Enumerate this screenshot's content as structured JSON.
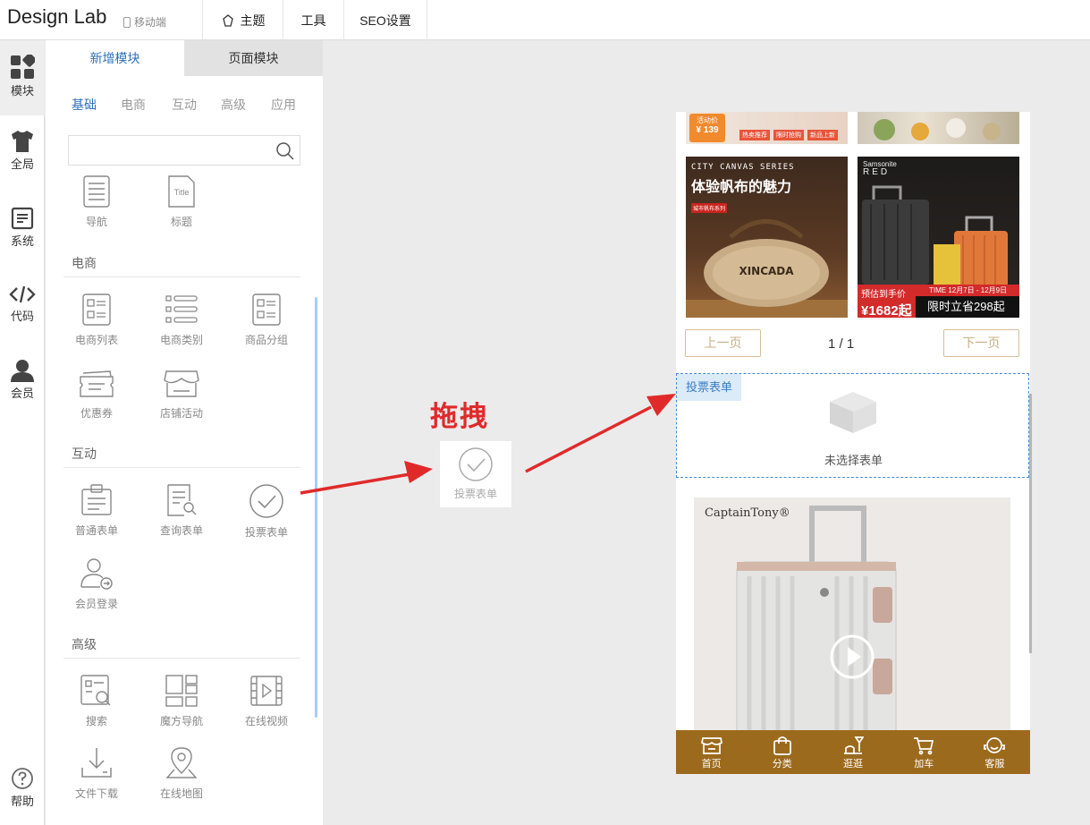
{
  "app": {
    "title": "Design Lab",
    "mobile_label": "移动端"
  },
  "topmenu": [
    {
      "label": "主题",
      "icon": "theme-icon"
    },
    {
      "label": "工具",
      "icon": ""
    },
    {
      "label": "SEO设置",
      "icon": ""
    }
  ],
  "leftbar": {
    "items": [
      {
        "label": "模块",
        "icon": "modules-icon",
        "active": true
      },
      {
        "label": "全局",
        "icon": "shirt-icon"
      },
      {
        "label": "系统",
        "icon": "document-icon"
      },
      {
        "label": "代码",
        "icon": "code-icon"
      },
      {
        "label": "会员",
        "icon": "user-icon"
      }
    ],
    "help": "帮助"
  },
  "panel": {
    "tabs": [
      {
        "label": "新增模块",
        "active": true
      },
      {
        "label": "页面模块",
        "active": false
      }
    ],
    "categories": [
      {
        "label": "基础",
        "active": true
      },
      {
        "label": "电商"
      },
      {
        "label": "互动"
      },
      {
        "label": "高级"
      },
      {
        "label": "应用"
      }
    ],
    "search_placeholder": "",
    "basic_items": [
      {
        "label": "导航",
        "icon": "nav-list-icon"
      },
      {
        "label": "标题",
        "icon": "title-icon"
      }
    ],
    "sections": {
      "ecommerce": {
        "title": "电商",
        "items": [
          {
            "label": "电商列表",
            "icon": "product-list-icon"
          },
          {
            "label": "电商类别",
            "icon": "category-list-icon"
          },
          {
            "label": "商品分组",
            "icon": "product-group-icon"
          },
          {
            "label": "优惠券",
            "icon": "coupon-icon"
          },
          {
            "label": "店铺活动",
            "icon": "store-activity-icon"
          }
        ]
      },
      "interactive": {
        "title": "互动",
        "items": [
          {
            "label": "普通表单",
            "icon": "form-icon"
          },
          {
            "label": "查询表单",
            "icon": "query-form-icon"
          },
          {
            "label": "投票表单",
            "icon": "vote-check-icon"
          },
          {
            "label": "会员登录",
            "icon": "member-login-icon"
          }
        ]
      },
      "advanced": {
        "title": "高级",
        "items": [
          {
            "label": "搜索",
            "icon": "search-module-icon"
          },
          {
            "label": "魔方导航",
            "icon": "grid-nav-icon"
          },
          {
            "label": "在线视频",
            "icon": "video-icon"
          },
          {
            "label": "文件下载",
            "icon": "download-icon"
          },
          {
            "label": "在线地图",
            "icon": "map-pin-icon"
          }
        ]
      }
    }
  },
  "drag": {
    "title": "拖拽",
    "item_label": "投票表单"
  },
  "phone": {
    "top_promo": {
      "tag": "活动价",
      "price": "¥ 139",
      "tabs": [
        "热卖推荐",
        "限时抢购",
        "新品上新"
      ]
    },
    "products": [
      {
        "series": "CITY CANVAS SERIES",
        "title": "体验帆布的魅力",
        "subtitle": "城市帆布系列",
        "bag_brand": "XINCADA"
      },
      {
        "brand": "Samsonite",
        "brand_sub": "RED",
        "presale": "预估到手价",
        "price": "¥1682起",
        "time": "TIME 12月7日 - 12月9日",
        "promo": "限时立省298起"
      }
    ],
    "pagination": {
      "prev": "上一页",
      "page": "1 / 1",
      "next": "下一页"
    },
    "vote_module": {
      "tag": "投票表单",
      "empty_text": "未选择表单"
    },
    "video": {
      "brand": "CaptainTony®"
    },
    "bottom_nav": [
      {
        "label": "首页",
        "icon": "store-icon"
      },
      {
        "label": "分类",
        "icon": "bag-icon"
      },
      {
        "label": "逛逛",
        "icon": "stroll-icon"
      },
      {
        "label": "加车",
        "icon": "cart-icon"
      },
      {
        "label": "客服",
        "icon": "service-icon"
      }
    ]
  },
  "colors": {
    "accent": "#2f6fb6",
    "arrow": "#e02a2a",
    "bottom_nav_bg": "#9c6a1d",
    "vote_tag_bg": "#dcebf8",
    "pager_border": "#d6bf94"
  }
}
